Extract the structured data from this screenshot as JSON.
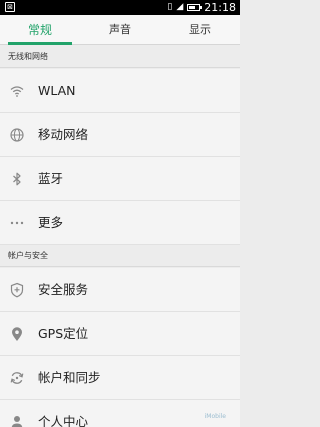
{
  "status_bar": {
    "left_glyph": "⊠",
    "time": "21:18",
    "icons": [
      "vibrate-icon",
      "signal-icon",
      "battery-icon"
    ],
    "battery_level": 0.7
  },
  "tabs": [
    {
      "label": "常规",
      "active": true
    },
    {
      "label": "声音",
      "active": false
    },
    {
      "label": "显示",
      "active": false
    }
  ],
  "sections": [
    {
      "title": "无线和网络",
      "items": [
        {
          "label": "WLAN",
          "icon": "wifi-icon"
        },
        {
          "label": "移动网络",
          "icon": "globe-icon"
        },
        {
          "label": "蓝牙",
          "icon": "bluetooth-icon"
        },
        {
          "label": "更多",
          "icon": "more-dots-icon"
        }
      ]
    },
    {
      "title": "帐户与安全",
      "items": [
        {
          "label": "安全服务",
          "icon": "shield-icon"
        },
        {
          "label": "GPS定位",
          "icon": "location-pin-icon"
        },
        {
          "label": "帐户和同步",
          "icon": "sync-icon"
        },
        {
          "label": "个人中心",
          "icon": "person-icon"
        }
      ]
    }
  ],
  "watermark": "iMobile"
}
